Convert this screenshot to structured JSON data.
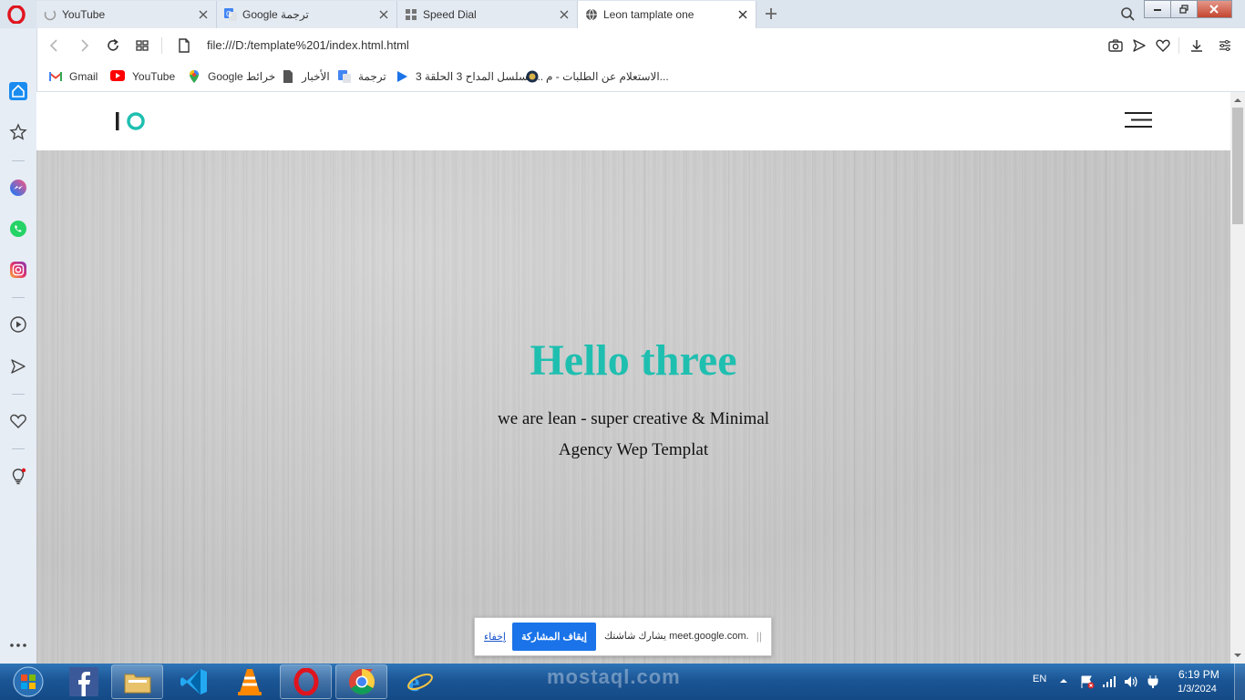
{
  "tabs": [
    {
      "title": "YouTube",
      "icon": "loading-icon",
      "active": false
    },
    {
      "title": "Google ترجمة",
      "icon": "google-translate-icon",
      "active": false
    },
    {
      "title": "Speed Dial",
      "icon": "speed-dial-icon",
      "active": false
    },
    {
      "title": "Leon tamplate one",
      "icon": "globe-icon",
      "active": true
    }
  ],
  "address": {
    "url": "file:///D:/template%201/index.html.html"
  },
  "bookmarks": [
    {
      "label": "Gmail",
      "icon": "gmail-icon"
    },
    {
      "label": "YouTube",
      "icon": "youtube-icon"
    },
    {
      "label": "Google خرائط",
      "icon": "google-maps-icon"
    },
    {
      "label": "الأخبار",
      "icon": "document-icon"
    },
    {
      "label": "ترجمة",
      "icon": "google-translate-icon"
    },
    {
      "label": "مسلسل المداح 3 الحلقة 3...",
      "icon": "play-icon"
    },
    {
      "label": "الاستعلام عن الطلبات - م...",
      "icon": "emblem-icon"
    }
  ],
  "site": {
    "logo": "IO",
    "hero_title": "Hello three",
    "hero_line1": "we are lean - super creative & Minimal",
    "hero_line2": "Agency Wep Templat"
  },
  "sharebar": {
    "hide_label": "إخفاء",
    "stop_label": "إيقاف المشاركة",
    "message": "يشارك شاشتك meet.google.com."
  },
  "taskbar": {
    "watermark": "mostaql.com",
    "language": "EN",
    "time": "6:19 PM",
    "date": "1/3/2024"
  },
  "colors": {
    "accent": "#1fbfb0",
    "tabbar": "#dce4ee",
    "taskbar": "#1b5595"
  }
}
